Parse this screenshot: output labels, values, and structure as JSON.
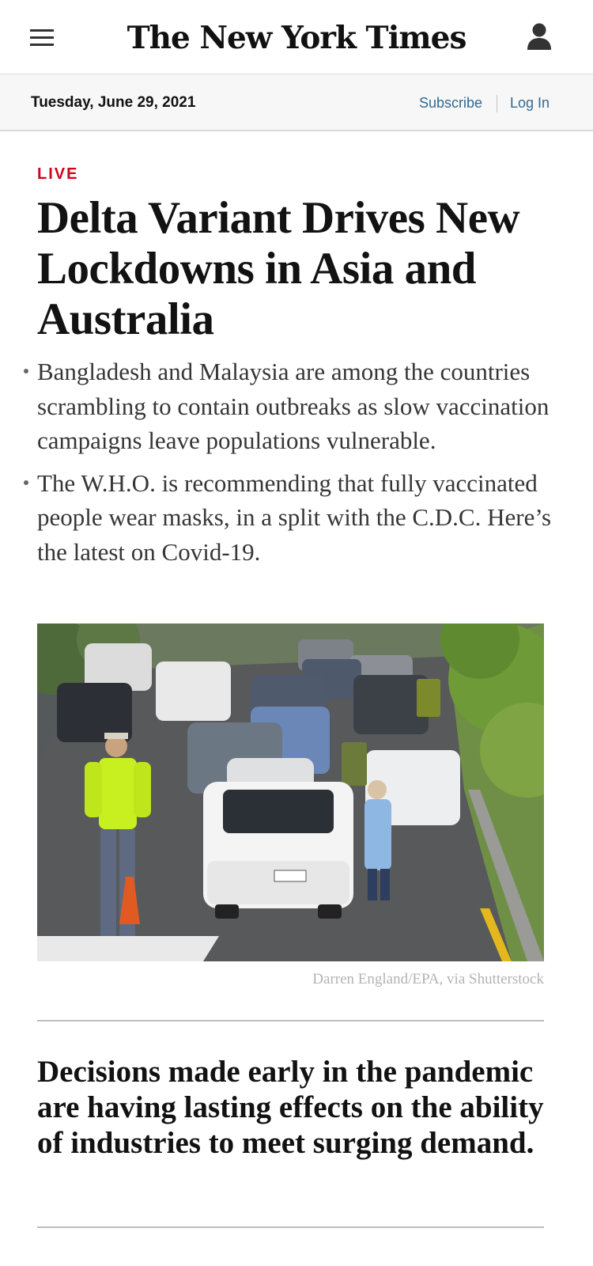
{
  "header": {
    "menu_icon": "hamburger-menu-icon",
    "masthead": "The New York Times",
    "account_icon": "user-account-icon"
  },
  "datebar": {
    "date": "Tuesday, June 29, 2021",
    "subscribe": "Subscribe",
    "login": "Log In"
  },
  "lead_story": {
    "label": "LIVE",
    "label_color": "#d0021b",
    "headline": "Delta Variant Drives New Lockdowns in Asia and Australia",
    "bullets": [
      "Bangladesh and Malaysia are among the countries scrambling to contain outbreaks as slow vaccination campaigns leave populations vulnerable.",
      "The W.H.O. is recommending that fully vaccinated people wear masks, in a split with the C.D.C. Here’s the latest on Covid-19."
    ],
    "photo_credit": "Darren England/EPA, via Shutterstock"
  },
  "second_story": {
    "headline": "Decisions made early in the pandemic are having lasting effects on the ability of industries to meet surging demand."
  },
  "colors": {
    "link": "#326891",
    "text": "#121212",
    "bullet_text": "#363636"
  }
}
